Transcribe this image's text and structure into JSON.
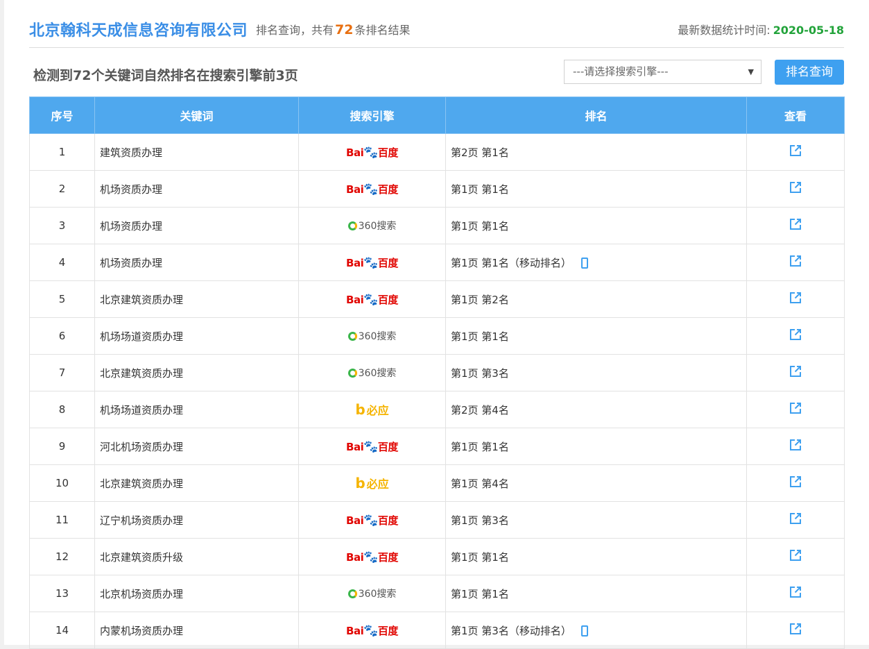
{
  "header": {
    "company": "北京翰科天成信息咨询有限公司",
    "summary_prefix": "排名查询，共有",
    "summary_count": "72",
    "summary_suffix": "条排名结果",
    "stat_label": "最新数据统计时间:",
    "stat_date": "2020-05-18"
  },
  "subheader": {
    "title": "检测到72个关键词自然排名在搜索引擎前3页",
    "select_placeholder": "---请选择搜索引擎---",
    "query_button": "排名查询"
  },
  "table": {
    "columns": [
      "序号",
      "关键词",
      "搜索引擎",
      "排名",
      "查看"
    ],
    "rows": [
      {
        "no": "1",
        "keyword": "建筑资质办理",
        "engine": "baidu",
        "rank": "第2页 第1名",
        "mobile": false
      },
      {
        "no": "2",
        "keyword": "机场资质办理",
        "engine": "baidu",
        "rank": "第1页 第1名",
        "mobile": false
      },
      {
        "no": "3",
        "keyword": "机场资质办理",
        "engine": "360",
        "rank": "第1页 第1名",
        "mobile": false
      },
      {
        "no": "4",
        "keyword": "机场资质办理",
        "engine": "baidu",
        "rank": "第1页 第1名（移动排名）",
        "mobile": true
      },
      {
        "no": "5",
        "keyword": "北京建筑资质办理",
        "engine": "baidu",
        "rank": "第1页 第2名",
        "mobile": false
      },
      {
        "no": "6",
        "keyword": "机场场道资质办理",
        "engine": "360",
        "rank": "第1页 第1名",
        "mobile": false
      },
      {
        "no": "7",
        "keyword": "北京建筑资质办理",
        "engine": "360",
        "rank": "第1页 第3名",
        "mobile": false
      },
      {
        "no": "8",
        "keyword": "机场场道资质办理",
        "engine": "bing",
        "rank": "第2页 第4名",
        "mobile": false
      },
      {
        "no": "9",
        "keyword": "河北机场资质办理",
        "engine": "baidu",
        "rank": "第1页 第1名",
        "mobile": false
      },
      {
        "no": "10",
        "keyword": "北京建筑资质办理",
        "engine": "bing",
        "rank": "第1页 第4名",
        "mobile": false
      },
      {
        "no": "11",
        "keyword": "辽宁机场资质办理",
        "engine": "baidu",
        "rank": "第1页 第3名",
        "mobile": false
      },
      {
        "no": "12",
        "keyword": "北京建筑资质升级",
        "engine": "baidu",
        "rank": "第1页 第1名",
        "mobile": false
      },
      {
        "no": "13",
        "keyword": "北京机场资质办理",
        "engine": "360",
        "rank": "第1页 第1名",
        "mobile": false
      },
      {
        "no": "14",
        "keyword": "内蒙机场资质办理",
        "engine": "baidu",
        "rank": "第1页 第3名（移动排名）",
        "mobile": true
      }
    ]
  },
  "engines": {
    "baidu": {
      "text1": "Bai",
      "paw": "🐾",
      "text2": "百度"
    },
    "360": {
      "text": "360搜索"
    },
    "bing": {
      "glyph": "b",
      "text": "必应"
    }
  },
  "colors": {
    "accent": "#3ea0f0",
    "header_blue": "#4fa8ee",
    "company_blue": "#3a8ee6",
    "count_orange": "#e87012",
    "date_green": "#22a33a",
    "baidu_red": "#e10602",
    "baidu_blue": "#2932e1",
    "so360_green": "#3ab54a",
    "bing_yellow": "#f5b400"
  },
  "icons": {
    "view": "external-link-icon",
    "mobile": "mobile-phone-icon"
  }
}
